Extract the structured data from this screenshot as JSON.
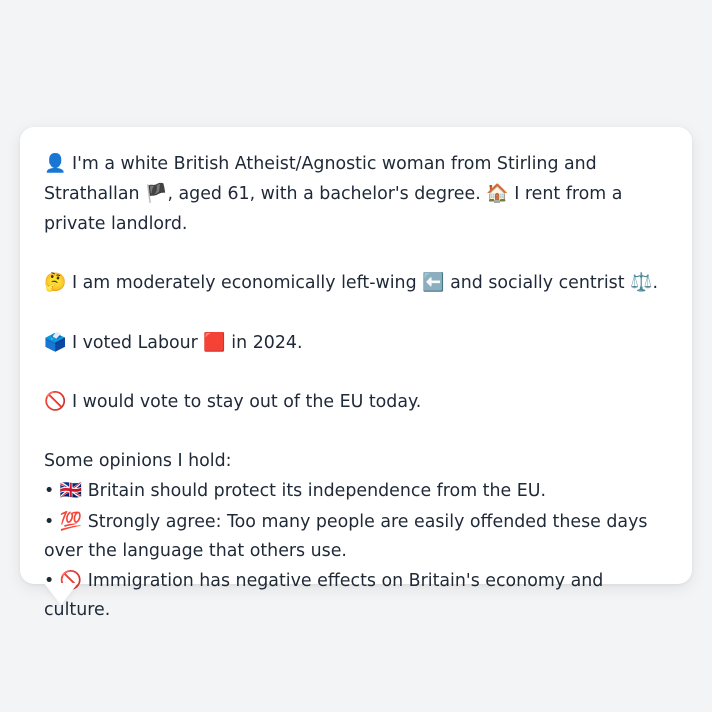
{
  "profile": {
    "identity": {
      "icon_1": "👤",
      "text_1": " I'm a white British Atheist/Agnostic woman from Stirling and Strathallan ",
      "icon_2": "🏴",
      "text_2": ", aged 61, with a bachelor's degree. ",
      "icon_3": "🏠",
      "text_3": " I rent from a private landlord."
    },
    "politics": {
      "icon_1": "🤔",
      "text_1": " I am moderately economically left-wing ",
      "icon_2": "⬅️",
      "text_2": " and socially centrist ",
      "icon_3": "⚖️",
      "text_3": "."
    },
    "vote": {
      "icon_1": "🗳️",
      "text_1": " I voted Labour ",
      "icon_2": "🟥",
      "text_2": " in 2024."
    },
    "eu": {
      "icon": "🚫",
      "text": " I would vote to stay out of the EU today."
    },
    "opinions": {
      "heading": "Some opinions I hold:",
      "items": [
        {
          "bullet": "• ",
          "icon": "🇬🇧",
          "text": " Britain should protect its independence from the EU."
        },
        {
          "bullet": "• ",
          "icon": "💯",
          "text": " Strongly agree: Too many people are easily offended these days over the language that others use."
        },
        {
          "bullet": "• ",
          "icon": "🚫",
          "text": " Immigration has negative effects on Britain's economy and culture."
        }
      ]
    }
  }
}
